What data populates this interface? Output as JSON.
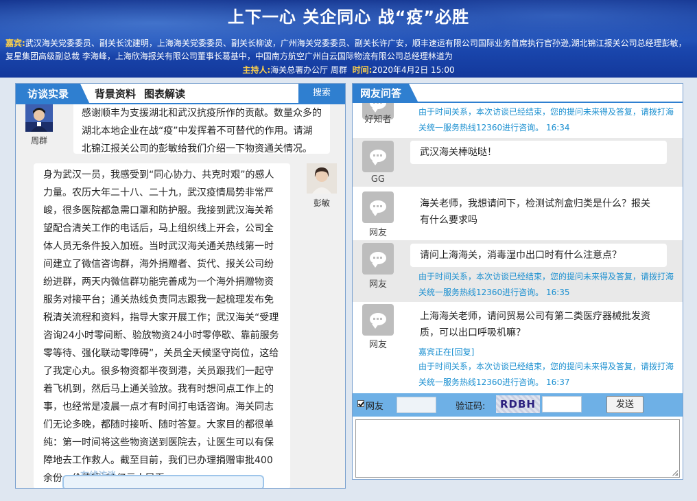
{
  "banner": {
    "title": "上下一心 关企同心 战“疫”必胜",
    "guests_label": "嘉宾:",
    "guests_text": "武汉海关党委委员、副关长沈建明，上海海关党委委员、副关长柳波，广州海关党委委员、副关长许广安，顺丰速运有限公司国际业务首席执行官孙逊,湖北锦江报关公司总经理彭敏，复星集团高级副总裁 李海峰，上海欣海报关有限公司董事长葛基中，中国南方航空广州白云国际物流有限公司总经理林道为",
    "host_label": "主持人:",
    "host_value": "海关总署办公厅 周群",
    "time_label": "时间:",
    "time_value": "2020年4月2日 15:00"
  },
  "left": {
    "tabs": [
      "访谈实录",
      "背景资料",
      "图表解读"
    ],
    "search_label": "搜索",
    "entries": [
      {
        "speaker": "周群",
        "text": "感谢顺丰为支援湖北和武汉抗疫所作的贡献。数量众多的湖北本地企业在战“疫”中发挥着不可替代的作用。请湖北锦江报关公司的彭敏给我们介绍一下物资通关情况。"
      },
      {
        "speaker": "彭敏",
        "text": "身为武汉一员，我感受到“同心协力、共克时艰”的感人力量。农历大年二十八、二十九，武汉疫情局势非常严峻，很多医院都急需口罩和防护服。我接到武汉海关希望配合清关工作的电话后，马上组织线上开会，公司全体人员无条件投入加班。当时武汉海关通关热线第一时间建立了微信咨询群，海外捐赠者、货代、报关公司纷纷进群，两天内微信群功能完善成为一个海外捐赠物资服务对接平台；通关热线负责同志跟我一起梳理发布免税清关流程和资料，指导大家开展工作；武汉海关“受理咨询24小时零间断、验放物资24小时零停歇、靠前服务零等待、强化联动零障碍”，关员全天候坚守岗位，这给了我定心丸。很多物资都半夜到港，关员跟我们一起守着飞机到，然后马上通关验放。我有时想问点工作上的事，也经常是凌晨一点才有时间打电话咨询。海关同志们无论多晚，都随时接听、随时答复。大家目的都很单纯：第一时间将这些物资送到医院去，让医生可以有保障地去工作救人。截至目前，我们已办理捐赠审批400余份，价值超过1亿元人民币。"
      }
    ],
    "stamp_text": "在线访谈"
  },
  "right": {
    "tab": "网友问答",
    "items": [
      {
        "name": "好知者",
        "text": "",
        "reply": "由于时间关系，本次访谈已经结束，您的提问未来得及答复，请拨打海关统一服务热线12360进行咨询。 16:34"
      },
      {
        "name": "GG",
        "text": "武汉海关棒哒哒！",
        "reply": ""
      },
      {
        "name": "网友",
        "text": "海关老师，我想请问下，检测试剂盒归类是什么？报关有什么要求吗",
        "reply": ""
      },
      {
        "name": "网友",
        "text": "请问上海海关，消毒湿巾出口时有什么注意点？",
        "reply": "由于时间关系，本次访谈已经结束，您的提问未来得及答复，请拨打海关统一服务热线12360进行咨询。 16:35"
      },
      {
        "name": "网友",
        "text": "上海海关老师，请问贸易公司有第二类医疗器械批发资质，可以出口呼吸机嘛？",
        "replying": "嘉宾正在[回复]",
        "reply": "由于时间关系，本次访谈已经结束，您的提问未来得及答复，请拨打海关统一服务热线12360进行咨询。 16:37"
      }
    ],
    "composer": {
      "checkbox_label": "网友",
      "nickname_value": "",
      "captcha_label": "验证码:",
      "captcha_text": "RDBH",
      "code_value": "",
      "send_label": "发送",
      "message_value": ""
    }
  }
}
